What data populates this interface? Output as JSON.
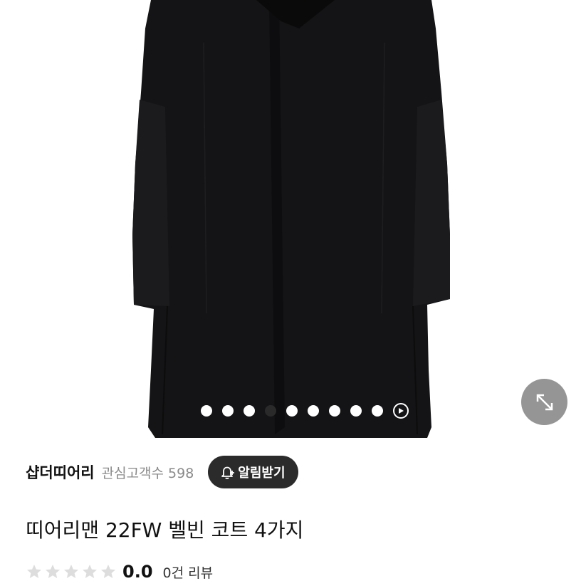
{
  "gallery": {
    "image_alt": "black coat product photo",
    "dot_count": 9,
    "active_dot_index": 3,
    "has_video_dot": true,
    "expand_icon": "expand-arrows-icon",
    "video_icon": "play-icon"
  },
  "shop": {
    "name": "샵더띠어리",
    "followers_label": "관심고객수",
    "followers_count": "598",
    "notify_label": "알림받기",
    "notify_icon": "bell-plus-icon"
  },
  "product": {
    "title": "띠어리맨 22FW 벨빈 코트 4가지"
  },
  "rating": {
    "score": "0.0",
    "review_count_label": "0건 리뷰",
    "stars_filled": 0,
    "stars_total": 5,
    "star_color_empty": "#dddddd"
  },
  "colors": {
    "notify_bg": "#2b2b2b",
    "coat": "#141416",
    "expand_bg": "#828282"
  }
}
